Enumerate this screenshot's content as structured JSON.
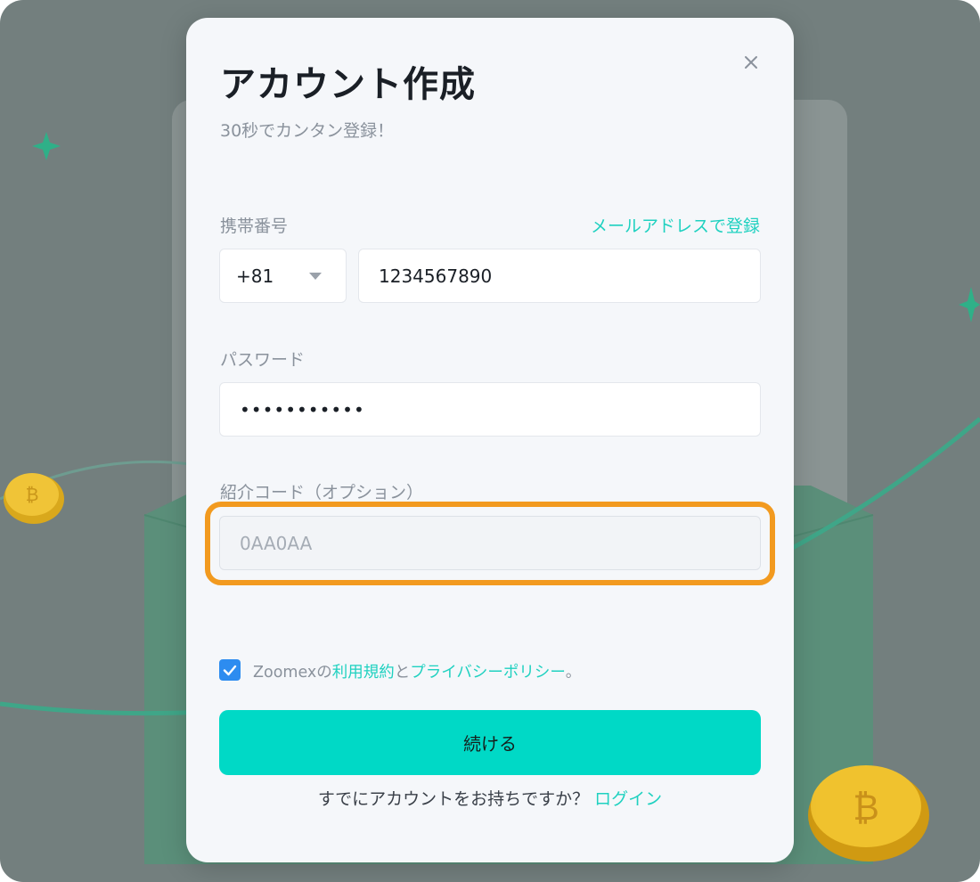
{
  "modal": {
    "title": "アカウント作成",
    "subtitle": "30秒でカンタン登録！",
    "close_icon": "close-icon",
    "phone_label": "携帯番号",
    "switch_to_email": "メールアドレスで登録",
    "country_code": "+81",
    "phone_value": "1234567890",
    "password_label": "パスワード",
    "password_value": "•••••••••••",
    "referral_label": "紹介コード（オプション）",
    "referral_placeholder": "0AA0AA",
    "terms": {
      "checked": true,
      "prefix": "Zoomexの",
      "terms_link": "利用規約",
      "middle": "と",
      "privacy_link": "プライバシーポリシー",
      "suffix": "。"
    },
    "continue_label": "続ける",
    "login_prompt": "すでにアカウントをお持ちですか？",
    "login_link": "ログイン"
  },
  "colors": {
    "accent": "#00d9c6",
    "link": "#1fd1c0",
    "highlight": "#f29a1f",
    "checkbox": "#2d8cf0",
    "backdrop": "#737f7e"
  }
}
